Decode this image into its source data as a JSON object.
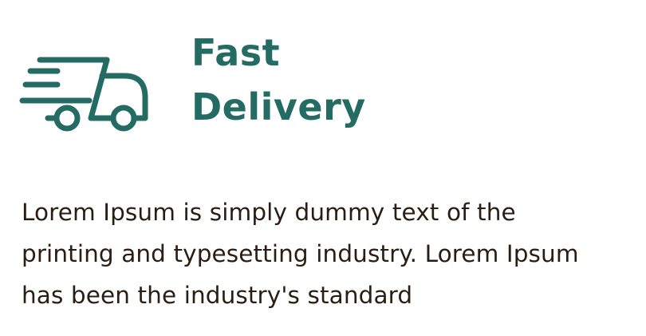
{
  "feature": {
    "icon": "fast-delivery-truck-icon",
    "title_line1": "Fast",
    "title_line2": "Delivery",
    "description": "Lorem Ipsum is simply dummy text of the printing and typesetting industry. Lorem Ipsum has been the industry's standard"
  },
  "colors": {
    "accent": "#246b64",
    "body_text": "#2a1d12",
    "background": "#ffffff"
  }
}
